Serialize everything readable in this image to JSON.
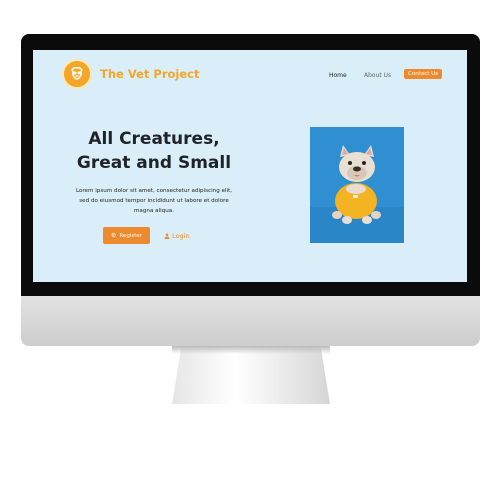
{
  "site": {
    "brand": "The Vet Project",
    "nav": {
      "home": "Home",
      "about": "About Us",
      "contact": "Contact Us"
    }
  },
  "hero": {
    "title_line1": "All Creatures,",
    "title_line2": "Great and Small",
    "body_line1": "Lorem ipsum dolor sit amet, consectetur adipiscing elit,",
    "body_line2": "sed do eiusmod tempor incididunt ut labore et dolore",
    "body_line3": "magna aliqua.",
    "register_label": "Register",
    "login_label": "Login"
  },
  "colors": {
    "accent": "#ec8a2d",
    "brand": "#f4a62a",
    "page_bg": "#d9eef8",
    "photo_bg": "#2f8fd0"
  },
  "icons": {
    "logo": "dog-paw-logo-icon",
    "register": "gear-icon",
    "login": "user-icon"
  }
}
